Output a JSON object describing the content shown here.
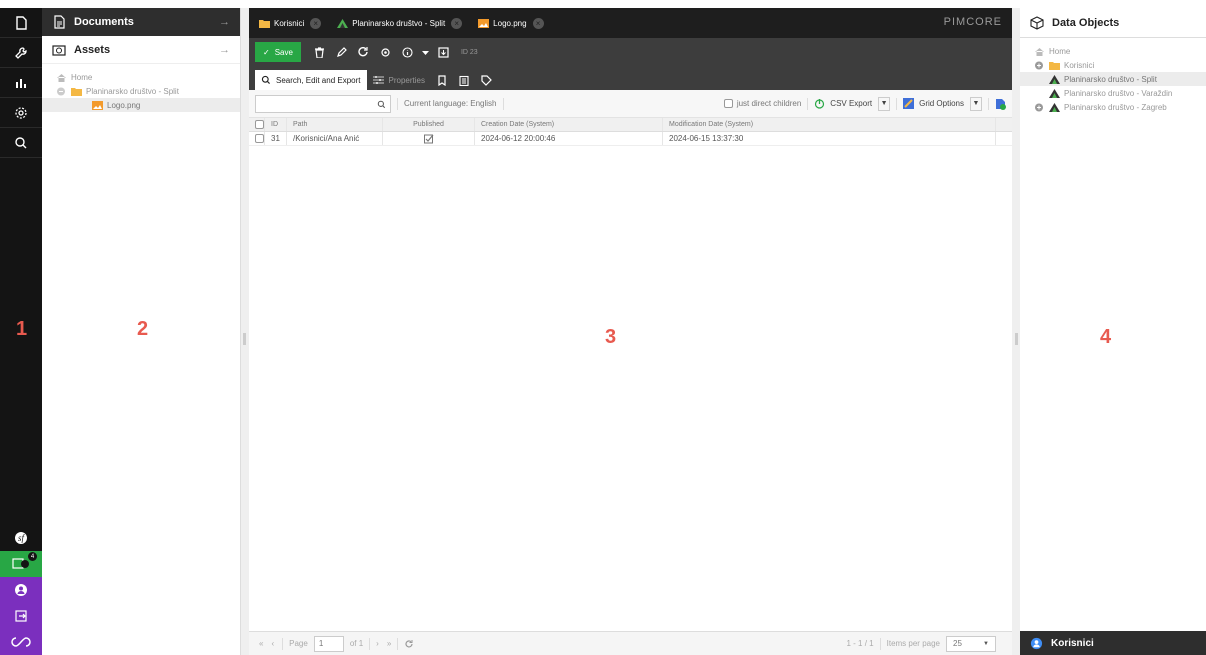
{
  "left_nav": {
    "items": [
      {
        "icon": "document-icon"
      },
      {
        "icon": "wrench-icon"
      },
      {
        "icon": "analytics-icon"
      },
      {
        "icon": "gear-icon"
      },
      {
        "icon": "search-icon"
      }
    ],
    "bottom_items": [
      {
        "icon": "symfony-icon"
      },
      {
        "icon": "notifications-icon",
        "badge": "4"
      },
      {
        "icon": "user-icon"
      },
      {
        "icon": "logout-icon"
      },
      {
        "icon": "pimcore-logo-icon"
      }
    ],
    "colors": {
      "bg": "#141414",
      "green": "#28a745",
      "purple": "#7b2fbe"
    }
  },
  "panel_numbers": {
    "p1": "1",
    "p2": "2",
    "p3": "3",
    "p4": "4"
  },
  "left_panel": {
    "documents_label": "Documents",
    "assets_label": "Assets",
    "tree": {
      "home": "Home",
      "folder": "Planinarsko društvo - Split",
      "file": "Logo.png"
    }
  },
  "editor": {
    "tabs": [
      {
        "label": "Korisnici",
        "icon": "folder-icon"
      },
      {
        "label": "Planinarsko društvo - Split",
        "icon": "mountain-icon"
      },
      {
        "label": "Logo.png",
        "icon": "image-icon"
      }
    ],
    "brand": "PIMCORE",
    "toolbar": {
      "save_label": "Save",
      "id_label": "ID 23"
    },
    "subtabs": {
      "search_label": "Search, Edit and Export",
      "properties_label": "Properties"
    },
    "grid_toolbar": {
      "language_label": "Current language: English",
      "direct_children_label": "just direct children",
      "csv_export_label": "CSV Export",
      "grid_options_label": "Grid Options"
    },
    "columns": [
      "ID",
      "Path",
      "Published",
      "Creation Date (System)",
      "Modification Date (System)"
    ],
    "rows": [
      {
        "id": "31",
        "path": "/Korisnici/Ana Anić",
        "published": true,
        "created": "2024-06-12 20:00:46",
        "modified": "2024-06-15 13:37:30"
      }
    ],
    "pager": {
      "page_label": "Page",
      "page_value": "1",
      "of_label": "of 1",
      "range_label": "1 - 1 / 1",
      "items_per_page_label": "Items per page",
      "items_per_page_value": "25"
    }
  },
  "right_panel": {
    "title": "Data Objects",
    "tree": {
      "home": "Home",
      "folder": "Korisnici",
      "items": [
        "Planinarsko društvo - Split",
        "Planinarsko društvo - Varaždin",
        "Planinarsko društvo - Zagreb"
      ]
    },
    "footer_label": "Korisnici"
  }
}
